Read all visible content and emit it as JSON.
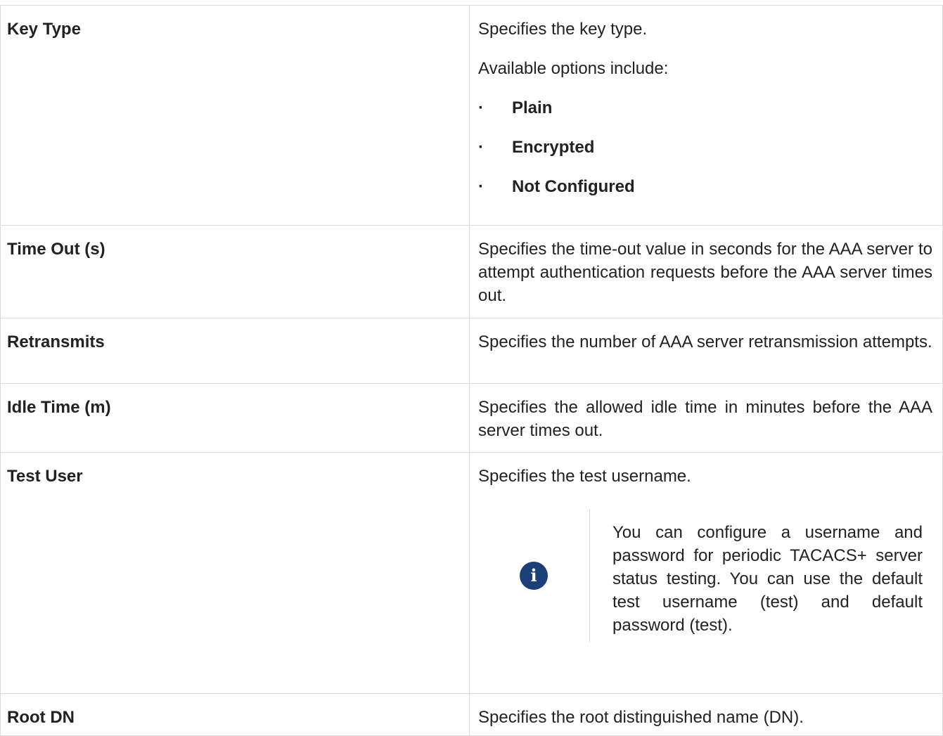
{
  "rows": [
    {
      "name": "Key Type",
      "description": "Specifies the key type.",
      "options_intro": "Available options include:",
      "options": [
        "Plain",
        "Encrypted",
        "Not Configured"
      ]
    },
    {
      "name": "Time Out (s)",
      "description": "Specifies the time-out value in seconds for the AAA server to attempt authentication requests before the AAA server times out."
    },
    {
      "name": "Retransmits",
      "description": "Specifies the number of AAA server retransmission attempts."
    },
    {
      "name": "Idle Time (m)",
      "description": "Specifies the allowed idle time in minutes before the AAA server times out."
    },
    {
      "name": "Test User",
      "description": "Specifies the test username.",
      "note_icon": "info-icon",
      "note": "You can configure a username and password for periodic TACACS+ server status testing. You can use the default test username (test) and default password (test)."
    },
    {
      "name": "Root DN",
      "description": "Specifies the root distinguished name (DN)."
    }
  ],
  "colors": {
    "border": "#dcdcdc",
    "text": "#222222",
    "info_icon_bg": "#1b4079"
  }
}
